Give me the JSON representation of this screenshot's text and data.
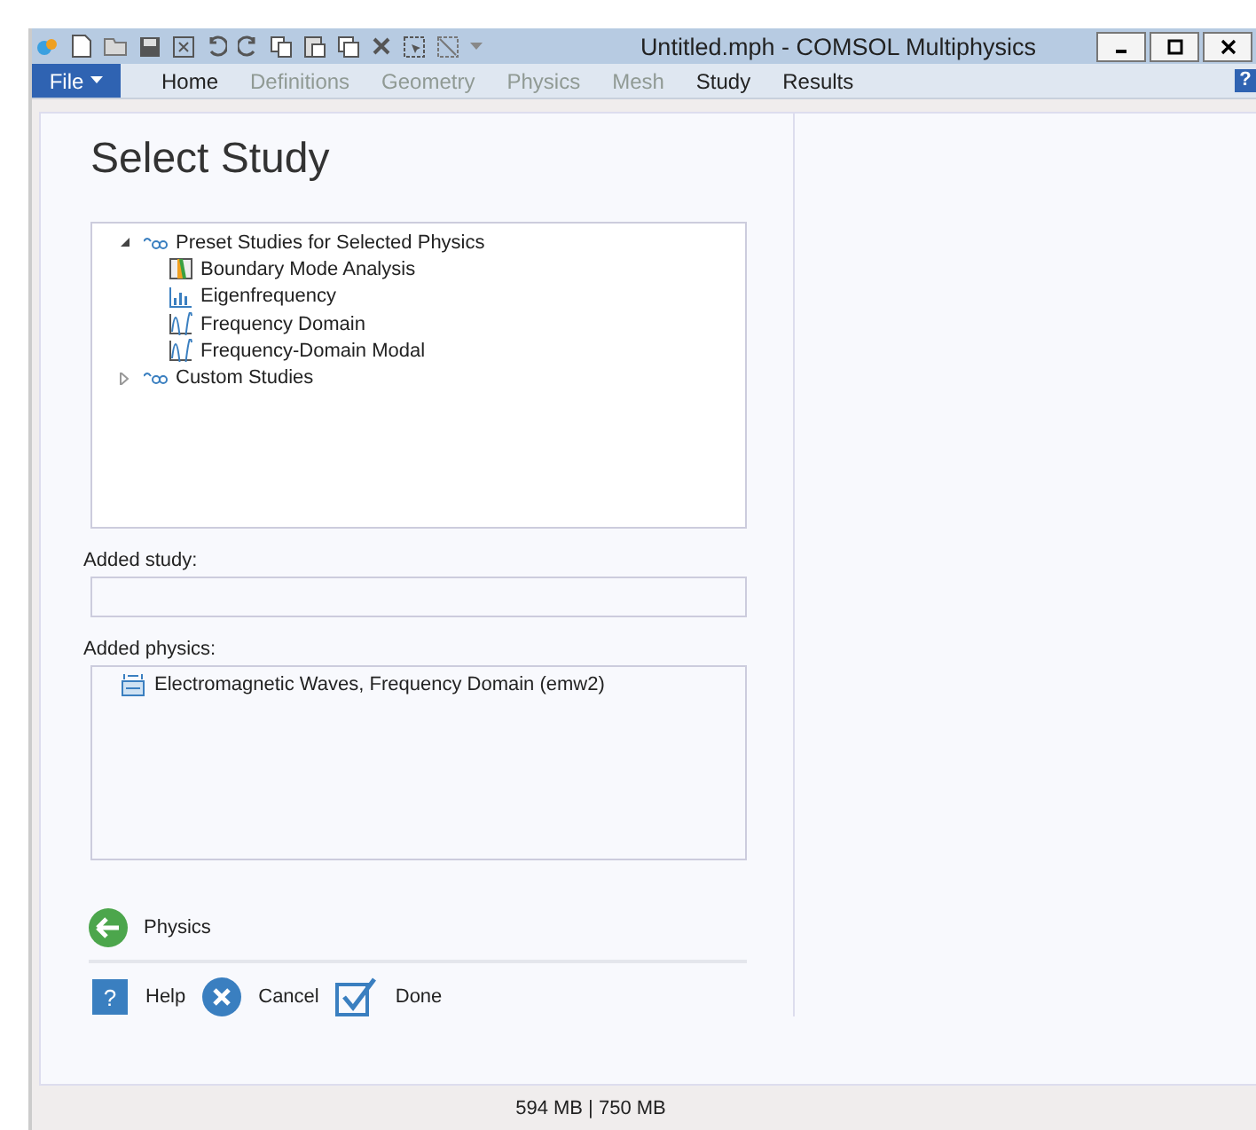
{
  "window": {
    "title": "Untitled.mph - COMSOL Multiphysics"
  },
  "file_menu": {
    "label": "File"
  },
  "ribbon_tabs": [
    {
      "label": "Home",
      "disabled": false
    },
    {
      "label": "Definitions",
      "disabled": true
    },
    {
      "label": "Geometry",
      "disabled": true
    },
    {
      "label": "Physics",
      "disabled": true
    },
    {
      "label": "Mesh",
      "disabled": true
    },
    {
      "label": "Study",
      "disabled": false
    },
    {
      "label": "Results",
      "disabled": false
    }
  ],
  "help_badge": "?",
  "page_title": "Select Study",
  "study_tree": [
    {
      "label": "Preset Studies for Selected Physics",
      "expanded": true,
      "children": [
        {
          "label": "Boundary Mode Analysis",
          "kind": "mode"
        },
        {
          "label": "Eigenfrequency",
          "kind": "eigen"
        },
        {
          "label": "Frequency Domain",
          "kind": "frequency"
        },
        {
          "label": "Frequency-Domain Modal",
          "kind": "frequency"
        }
      ]
    },
    {
      "label": "Custom Studies",
      "expanded": false
    }
  ],
  "added_study": {
    "label": "Added study:"
  },
  "added_physics": {
    "label": "Added physics:",
    "items": [
      "Electromagnetic Waves, Frequency Domain (emw2)"
    ]
  },
  "back_button": {
    "label": "Physics"
  },
  "actions": [
    {
      "label": "Help",
      "kind": "help",
      "glyph": "?"
    },
    {
      "label": "Cancel",
      "kind": "cancel"
    },
    {
      "label": "Done",
      "kind": "done"
    }
  ],
  "status_bar": {
    "memory": "594 MB | 750 MB"
  }
}
